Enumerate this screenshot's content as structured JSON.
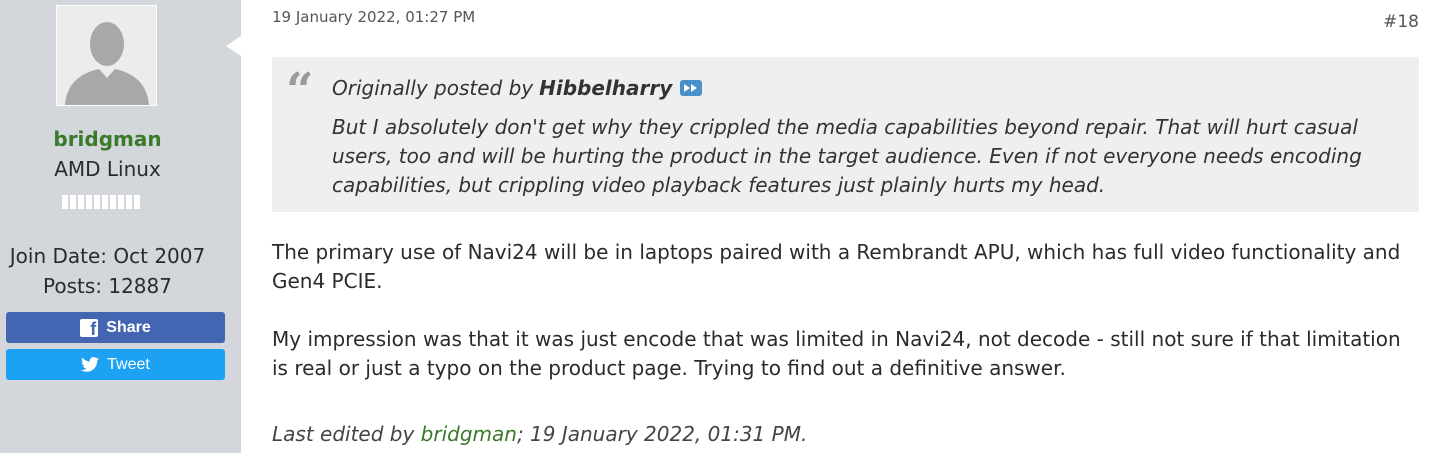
{
  "sidebar": {
    "username": "bridgman",
    "user_title": "AMD Linux",
    "join_date": "Join Date: Oct 2007",
    "posts": "Posts: 12887",
    "share_label": "Share",
    "tweet_label": "Tweet",
    "avatar_icon": "default-avatar-icon",
    "reputation_segments": 10,
    "colors": {
      "sidebar_bg": "#d3d7db",
      "username": "#3a7a2a",
      "share": "#4466b2",
      "tweet": "#1da1f2"
    }
  },
  "post": {
    "date": "19 January 2022, 01:27 PM",
    "number": "#18",
    "quote": {
      "prefix": "Originally posted by",
      "author": "Hibbelharry",
      "text": "But I absolutely don't get why they crippled the media capabilities beyond repair. That will hurt casual users, too and will be hurting the product in the target audience. Even if not everyone needs encoding capabilities, but crippling video playback features just plainly hurts my head."
    },
    "paragraphs": [
      "The primary use of Navi24 will be in laptops paired with a Rembrandt APU, which has full video functionality and Gen4 PCIE.",
      "My impression was that it was just encode that was limited in Navi24, not decode - still not sure if that limitation is real or just a typo on the product page. Trying to find out a definitive answer."
    ],
    "last_edited": {
      "prefix": "Last edited by",
      "user": "bridgman",
      "suffix": "; 19 January 2022, 01:31 PM."
    }
  }
}
